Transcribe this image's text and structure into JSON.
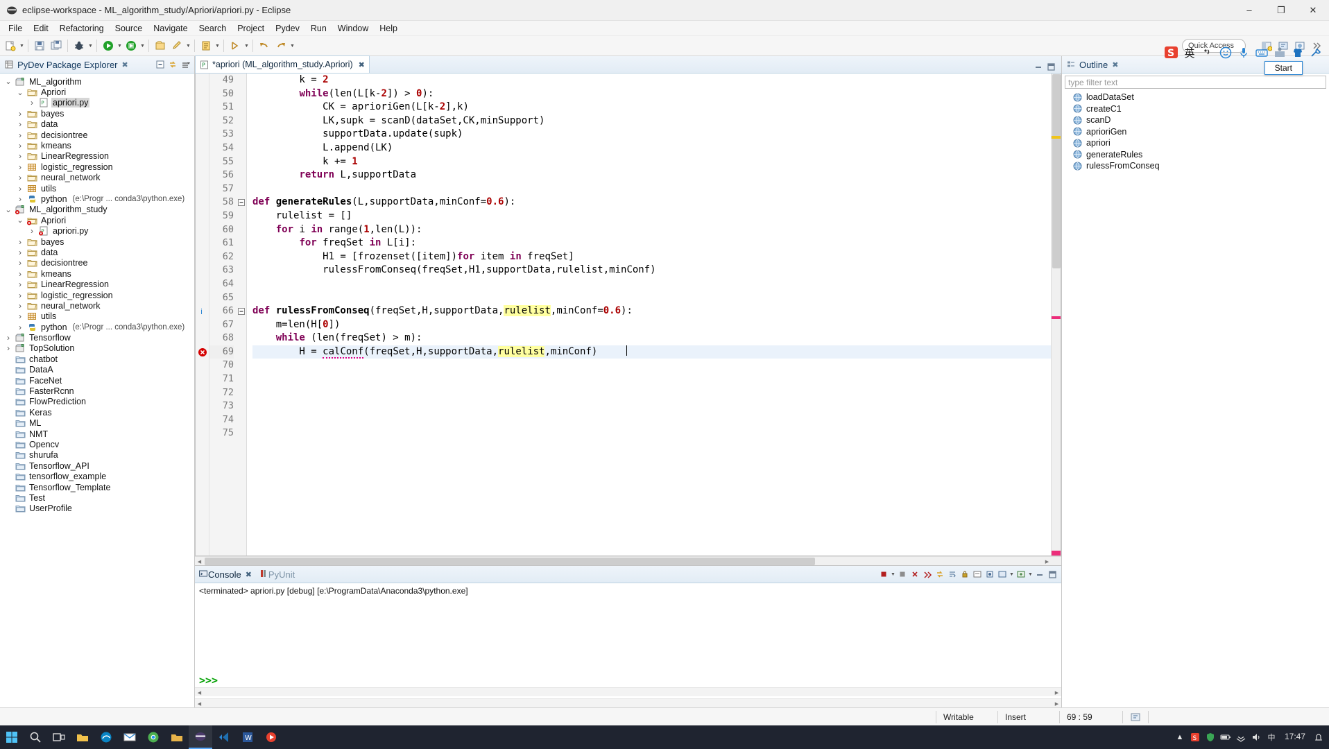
{
  "window": {
    "title": "eclipse-workspace - ML_algorithm_study/Apriori/apriori.py - Eclipse",
    "app_icon": "eclipse-icon",
    "minimize": "–",
    "maximize": "❐",
    "close": "✕"
  },
  "menu": {
    "items": [
      "File",
      "Edit",
      "Refactoring",
      "Source",
      "Navigate",
      "Search",
      "Project",
      "Pydev",
      "Run",
      "Window",
      "Help"
    ]
  },
  "toolbar": {
    "quick_access_placeholder": "Quick Access",
    "quick_access_value": "Quick Access"
  },
  "explorer": {
    "title": "PyDev Package Explorer",
    "close_glyph": "✖",
    "tools": [
      "collapse-all-icon",
      "link-with-editor-icon",
      "view-menu-icon"
    ],
    "tree": [
      {
        "indent": 0,
        "twist": "down",
        "icon": "project-icon",
        "label": "ML_algorithm",
        "dim": "",
        "selected": false
      },
      {
        "indent": 1,
        "twist": "down",
        "icon": "folder-src-icon",
        "label": "Apriori",
        "dim": "",
        "selected": false
      },
      {
        "indent": 2,
        "twist": "right",
        "icon": "python-file-icon",
        "label": "apriori.py",
        "dim": "",
        "selected": true
      },
      {
        "indent": 1,
        "twist": "right",
        "icon": "folder-src-icon",
        "label": "bayes",
        "dim": "",
        "selected": false
      },
      {
        "indent": 1,
        "twist": "right",
        "icon": "folder-src-icon",
        "label": "data",
        "dim": "",
        "selected": false
      },
      {
        "indent": 1,
        "twist": "right",
        "icon": "folder-src-icon",
        "label": "decisiontree",
        "dim": "",
        "selected": false
      },
      {
        "indent": 1,
        "twist": "right",
        "icon": "folder-src-icon",
        "label": "kmeans",
        "dim": "",
        "selected": false
      },
      {
        "indent": 1,
        "twist": "right",
        "icon": "folder-src-icon",
        "label": "LinearRegression",
        "dim": "",
        "selected": false
      },
      {
        "indent": 1,
        "twist": "right",
        "icon": "grid-icon",
        "label": "logistic_regression",
        "dim": "",
        "selected": false
      },
      {
        "indent": 1,
        "twist": "right",
        "icon": "folder-src-icon",
        "label": "neural_network",
        "dim": "",
        "selected": false
      },
      {
        "indent": 1,
        "twist": "right",
        "icon": "grid-icon",
        "label": "utils",
        "dim": "",
        "selected": false
      },
      {
        "indent": 1,
        "twist": "right",
        "icon": "python-interp-icon",
        "label": "python",
        "dim": "(e:\\Progr ... conda3\\python.exe)",
        "selected": false
      },
      {
        "indent": 0,
        "twist": "down",
        "icon": "project-error-icon",
        "label": "ML_algorithm_study",
        "dim": "",
        "selected": false
      },
      {
        "indent": 1,
        "twist": "down",
        "icon": "folder-error-icon",
        "label": "Apriori",
        "dim": "",
        "selected": false
      },
      {
        "indent": 2,
        "twist": "right",
        "icon": "python-file-error-icon",
        "label": "apriori.py",
        "dim": "",
        "selected": false
      },
      {
        "indent": 1,
        "twist": "right",
        "icon": "folder-src-icon",
        "label": "bayes",
        "dim": "",
        "selected": false
      },
      {
        "indent": 1,
        "twist": "right",
        "icon": "folder-src-icon",
        "label": "data",
        "dim": "",
        "selected": false
      },
      {
        "indent": 1,
        "twist": "right",
        "icon": "folder-src-icon",
        "label": "decisiontree",
        "dim": "",
        "selected": false
      },
      {
        "indent": 1,
        "twist": "right",
        "icon": "folder-src-icon",
        "label": "kmeans",
        "dim": "",
        "selected": false
      },
      {
        "indent": 1,
        "twist": "right",
        "icon": "folder-src-icon",
        "label": "LinearRegression",
        "dim": "",
        "selected": false
      },
      {
        "indent": 1,
        "twist": "right",
        "icon": "folder-src-icon",
        "label": "logistic_regression",
        "dim": "",
        "selected": false
      },
      {
        "indent": 1,
        "twist": "right",
        "icon": "folder-src-icon",
        "label": "neural_network",
        "dim": "",
        "selected": false
      },
      {
        "indent": 1,
        "twist": "right",
        "icon": "grid-icon",
        "label": "utils",
        "dim": "",
        "selected": false
      },
      {
        "indent": 1,
        "twist": "right",
        "icon": "python-interp-icon",
        "label": "python",
        "dim": "(e:\\Progr ... conda3\\python.exe)",
        "selected": false
      },
      {
        "indent": 0,
        "twist": "right",
        "icon": "project-icon",
        "label": "Tensorflow",
        "dim": "",
        "selected": false
      },
      {
        "indent": 0,
        "twist": "right",
        "icon": "project-icon",
        "label": "TopSolution",
        "dim": "",
        "selected": false
      },
      {
        "indent": 0,
        "twist": "none",
        "icon": "closed-folder-icon",
        "label": "chatbot",
        "dim": "",
        "selected": false
      },
      {
        "indent": 0,
        "twist": "none",
        "icon": "closed-folder-icon",
        "label": "DataA",
        "dim": "",
        "selected": false
      },
      {
        "indent": 0,
        "twist": "none",
        "icon": "closed-folder-icon",
        "label": "FaceNet",
        "dim": "",
        "selected": false
      },
      {
        "indent": 0,
        "twist": "none",
        "icon": "closed-folder-icon",
        "label": "FasterRcnn",
        "dim": "",
        "selected": false
      },
      {
        "indent": 0,
        "twist": "none",
        "icon": "closed-folder-icon",
        "label": "FlowPrediction",
        "dim": "",
        "selected": false
      },
      {
        "indent": 0,
        "twist": "none",
        "icon": "closed-folder-icon",
        "label": "Keras",
        "dim": "",
        "selected": false
      },
      {
        "indent": 0,
        "twist": "none",
        "icon": "closed-folder-icon",
        "label": "ML",
        "dim": "",
        "selected": false
      },
      {
        "indent": 0,
        "twist": "none",
        "icon": "closed-folder-icon",
        "label": "NMT",
        "dim": "",
        "selected": false
      },
      {
        "indent": 0,
        "twist": "none",
        "icon": "closed-folder-icon",
        "label": "Opencv",
        "dim": "",
        "selected": false
      },
      {
        "indent": 0,
        "twist": "none",
        "icon": "closed-folder-icon",
        "label": "shurufa",
        "dim": "",
        "selected": false
      },
      {
        "indent": 0,
        "twist": "none",
        "icon": "closed-folder-icon",
        "label": "Tensorflow_API",
        "dim": "",
        "selected": false
      },
      {
        "indent": 0,
        "twist": "none",
        "icon": "closed-folder-icon",
        "label": "tensorflow_example",
        "dim": "",
        "selected": false
      },
      {
        "indent": 0,
        "twist": "none",
        "icon": "closed-folder-icon",
        "label": "Tensorflow_Template",
        "dim": "",
        "selected": false
      },
      {
        "indent": 0,
        "twist": "none",
        "icon": "closed-folder-icon",
        "label": "Test",
        "dim": "",
        "selected": false
      },
      {
        "indent": 0,
        "twist": "none",
        "icon": "closed-folder-icon",
        "label": "UserProfile",
        "dim": "",
        "selected": false
      }
    ]
  },
  "editor": {
    "tab_label": "*apriori (ML_algorithm_study.Apriori)",
    "tab_icon": "python-file-icon",
    "tab_close": "✖",
    "first_line": 49,
    "lines": [
      {
        "n": 49,
        "marker": "",
        "fold": "",
        "cur": false,
        "tokens": [
          {
            "t": "        k = ",
            "c": ""
          },
          {
            "t": "2",
            "c": "num"
          }
        ]
      },
      {
        "n": 50,
        "marker": "",
        "fold": "",
        "cur": false,
        "tokens": [
          {
            "t": "        ",
            "c": ""
          },
          {
            "t": "while",
            "c": "kw"
          },
          {
            "t": "(len(L[k-",
            "c": ""
          },
          {
            "t": "2",
            "c": "num"
          },
          {
            "t": "]) > ",
            "c": ""
          },
          {
            "t": "0",
            "c": "num"
          },
          {
            "t": "):",
            "c": ""
          }
        ]
      },
      {
        "n": 51,
        "marker": "",
        "fold": "",
        "cur": false,
        "tokens": [
          {
            "t": "            CK = aprioriGen(L[k-",
            "c": ""
          },
          {
            "t": "2",
            "c": "num"
          },
          {
            "t": "],k)",
            "c": ""
          }
        ]
      },
      {
        "n": 52,
        "marker": "",
        "fold": "",
        "cur": false,
        "tokens": [
          {
            "t": "            LK,supk = scanD(dataSet,CK,minSupport)",
            "c": ""
          }
        ]
      },
      {
        "n": 53,
        "marker": "",
        "fold": "",
        "cur": false,
        "tokens": [
          {
            "t": "            supportData.update(supk)",
            "c": ""
          }
        ]
      },
      {
        "n": 54,
        "marker": "",
        "fold": "",
        "cur": false,
        "tokens": [
          {
            "t": "            L.append(LK)",
            "c": ""
          }
        ]
      },
      {
        "n": 55,
        "marker": "",
        "fold": "",
        "cur": false,
        "tokens": [
          {
            "t": "            k += ",
            "c": ""
          },
          {
            "t": "1",
            "c": "num"
          }
        ]
      },
      {
        "n": 56,
        "marker": "",
        "fold": "",
        "cur": false,
        "tokens": [
          {
            "t": "        ",
            "c": ""
          },
          {
            "t": "return",
            "c": "kw"
          },
          {
            "t": " L,supportData",
            "c": ""
          }
        ]
      },
      {
        "n": 57,
        "marker": "",
        "fold": "",
        "cur": false,
        "tokens": [
          {
            "t": "",
            "c": ""
          }
        ]
      },
      {
        "n": 58,
        "marker": "",
        "fold": "minus",
        "cur": false,
        "tokens": [
          {
            "t": "def ",
            "c": "kw"
          },
          {
            "t": "generateRules",
            "c": "fn"
          },
          {
            "t": "(L,supportData,minConf=",
            "c": ""
          },
          {
            "t": "0.6",
            "c": "num"
          },
          {
            "t": "):",
            "c": ""
          }
        ]
      },
      {
        "n": 59,
        "marker": "",
        "fold": "",
        "cur": false,
        "tokens": [
          {
            "t": "    rulelist = []",
            "c": ""
          }
        ]
      },
      {
        "n": 60,
        "marker": "",
        "fold": "",
        "cur": false,
        "tokens": [
          {
            "t": "    ",
            "c": ""
          },
          {
            "t": "for",
            "c": "kw"
          },
          {
            "t": " i ",
            "c": ""
          },
          {
            "t": "in",
            "c": "kw"
          },
          {
            "t": " range(",
            "c": ""
          },
          {
            "t": "1",
            "c": "num"
          },
          {
            "t": ",len(L)):",
            "c": ""
          }
        ]
      },
      {
        "n": 61,
        "marker": "",
        "fold": "",
        "cur": false,
        "tokens": [
          {
            "t": "        ",
            "c": ""
          },
          {
            "t": "for",
            "c": "kw"
          },
          {
            "t": " freqSet ",
            "c": ""
          },
          {
            "t": "in",
            "c": "kw"
          },
          {
            "t": " L[i]:",
            "c": ""
          }
        ]
      },
      {
        "n": 62,
        "marker": "",
        "fold": "",
        "cur": false,
        "tokens": [
          {
            "t": "            H1 = [frozenset([item])",
            "c": ""
          },
          {
            "t": "for",
            "c": "kw"
          },
          {
            "t": " item ",
            "c": ""
          },
          {
            "t": "in",
            "c": "kw"
          },
          {
            "t": " freqSet]",
            "c": ""
          }
        ]
      },
      {
        "n": 63,
        "marker": "",
        "fold": "",
        "cur": false,
        "tokens": [
          {
            "t": "            rulessFromConseq(freqSet,H1,supportData,rulelist,minConf)",
            "c": ""
          }
        ]
      },
      {
        "n": 64,
        "marker": "",
        "fold": "",
        "cur": false,
        "tokens": [
          {
            "t": "",
            "c": ""
          }
        ]
      },
      {
        "n": 65,
        "marker": "",
        "fold": "",
        "cur": false,
        "tokens": [
          {
            "t": "",
            "c": ""
          }
        ]
      },
      {
        "n": 66,
        "marker": "info",
        "fold": "minus",
        "cur": false,
        "tokens": [
          {
            "t": "def ",
            "c": "kw"
          },
          {
            "t": "rulessFromConseq",
            "c": "fn"
          },
          {
            "t": "(freqSet,H,supportData,",
            "c": ""
          },
          {
            "t": "rulelist",
            "c": "hl"
          },
          {
            "t": ",minConf=",
            "c": ""
          },
          {
            "t": "0.6",
            "c": "num"
          },
          {
            "t": "):",
            "c": ""
          }
        ]
      },
      {
        "n": 67,
        "marker": "",
        "fold": "",
        "cur": false,
        "tokens": [
          {
            "t": "    m=len(H[",
            "c": ""
          },
          {
            "t": "0",
            "c": "num"
          },
          {
            "t": "])",
            "c": ""
          }
        ]
      },
      {
        "n": 68,
        "marker": "",
        "fold": "",
        "cur": false,
        "tokens": [
          {
            "t": "    ",
            "c": ""
          },
          {
            "t": "while",
            "c": "kw"
          },
          {
            "t": " (len(freqSet) > m):",
            "c": ""
          }
        ]
      },
      {
        "n": 69,
        "marker": "error",
        "fold": "",
        "cur": true,
        "tokens": [
          {
            "t": "        H = ",
            "c": ""
          },
          {
            "t": "calConf",
            "c": "squig"
          },
          {
            "t": "(freqSet,H,supportData,",
            "c": ""
          },
          {
            "t": "rulelist",
            "c": "hl"
          },
          {
            "t": ",minConf)",
            "c": ""
          }
        ]
      },
      {
        "n": 70,
        "marker": "",
        "fold": "",
        "cur": false,
        "tokens": [
          {
            "t": "",
            "c": ""
          }
        ]
      },
      {
        "n": 71,
        "marker": "",
        "fold": "",
        "cur": false,
        "tokens": [
          {
            "t": "",
            "c": ""
          }
        ]
      },
      {
        "n": 72,
        "marker": "",
        "fold": "",
        "cur": false,
        "tokens": [
          {
            "t": "",
            "c": ""
          }
        ]
      },
      {
        "n": 73,
        "marker": "",
        "fold": "",
        "cur": false,
        "tokens": [
          {
            "t": "",
            "c": ""
          }
        ]
      },
      {
        "n": 74,
        "marker": "",
        "fold": "",
        "cur": false,
        "tokens": [
          {
            "t": "",
            "c": ""
          }
        ]
      },
      {
        "n": 75,
        "marker": "",
        "fold": "",
        "cur": false,
        "tokens": [
          {
            "t": "",
            "c": ""
          }
        ]
      }
    ]
  },
  "console": {
    "tabs": [
      {
        "label": "Console",
        "icon": "console-icon",
        "active": true,
        "close": "✖"
      },
      {
        "label": "PyUnit",
        "icon": "pyunit-icon",
        "active": false,
        "close": ""
      }
    ],
    "terminated_line": "<terminated> apriori.py [debug] [e:\\ProgramData\\Anaconda3\\python.exe]",
    "prompt": ">>>"
  },
  "outline": {
    "title": "Outline",
    "close_glyph": "✖",
    "filter_placeholder": "type filter text",
    "items": [
      {
        "icon": "method-icon",
        "label": "loadDataSet"
      },
      {
        "icon": "method-icon",
        "label": "createC1"
      },
      {
        "icon": "method-icon",
        "label": "scanD"
      },
      {
        "icon": "method-icon",
        "label": "aprioriGen"
      },
      {
        "icon": "method-icon",
        "label": "apriori"
      },
      {
        "icon": "method-icon",
        "label": "generateRules"
      },
      {
        "icon": "method-icon",
        "label": "rulessFromConseq"
      }
    ]
  },
  "ime": {
    "logo": "sogou-logo-icon",
    "mode": "英",
    "buttons": [
      "pinyin-toggle-icon",
      "emoji-icon",
      "microphone-icon",
      "keyboard-icon",
      "toolbox-icon",
      "skin-icon",
      "settings-icon"
    ],
    "tooltip": "Start"
  },
  "statusbar": {
    "writable": "Writable",
    "insert_mode": "Insert",
    "position": "69 : 59"
  },
  "taskbar": {
    "start": "start-icon",
    "items": [
      "search-icon",
      "taskview-icon",
      "explorer-icon",
      "edge-icon",
      "mail-icon",
      "chrome-icon",
      "folder-icon",
      "eclipse-icon",
      "vscode-icon",
      "word-icon",
      "player-icon"
    ],
    "tray": [
      "up-arrow-icon",
      "shield-icon",
      "network-icon",
      "sound-icon",
      "chinese-ime-icon",
      "notification-icon"
    ],
    "time": "17:47",
    "date": ""
  },
  "colors": {
    "accent": "#2c86d4",
    "keyword": "#7f0055",
    "number": "#aa0000",
    "highlight": "#ffffa0",
    "error": "#d40000",
    "prompt_green": "#00a000",
    "tab_gradient_top": "#eef4fa",
    "tab_gradient_bottom": "#e2ecf5"
  }
}
